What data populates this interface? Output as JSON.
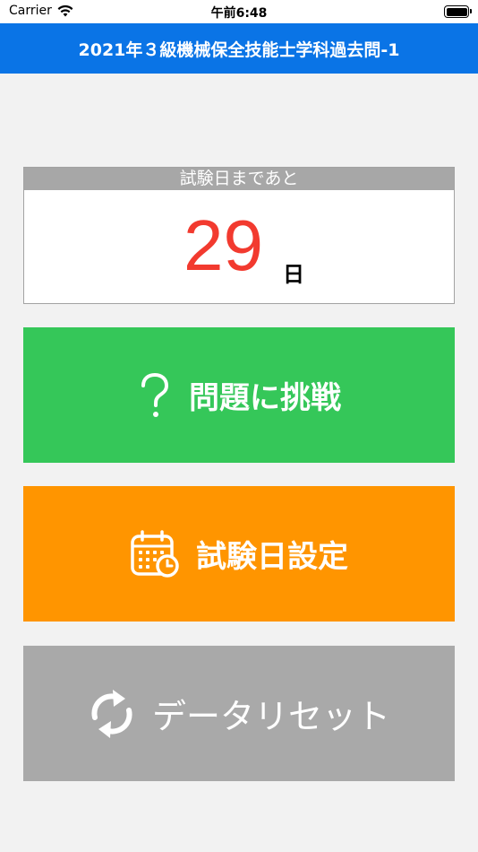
{
  "status_bar": {
    "carrier": "Carrier",
    "time": "午前6:48"
  },
  "nav": {
    "title": "2021年３級機械保全技能士学科過去問-1"
  },
  "countdown": {
    "header": "試験日まであと",
    "days": "29",
    "unit": "日"
  },
  "buttons": {
    "challenge": {
      "label": "問題に挑戦",
      "icon": "question-mark-icon",
      "color": "#35c759"
    },
    "exam_date": {
      "label": "試験日設定",
      "icon": "calendar-clock-icon",
      "color": "#ff9500"
    },
    "reset": {
      "label": "データリセット",
      "icon": "refresh-icon",
      "color": "#a9a9a9"
    }
  },
  "colors": {
    "nav_bar": "#0a74e6",
    "countdown_number": "#f23a2f",
    "countdown_header": "#a7a7a7"
  }
}
